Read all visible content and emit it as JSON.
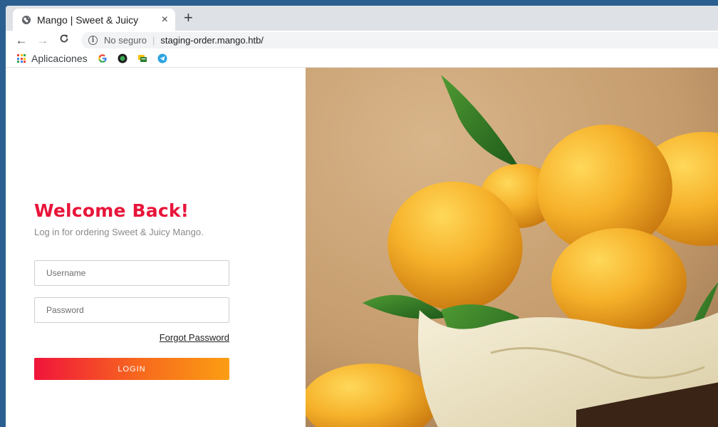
{
  "browser": {
    "tab_title": "Mango | Sweet & Juicy",
    "tab_close": "×",
    "new_tab": "+",
    "nav": {
      "back": "←",
      "forward": "→",
      "reload": "C"
    },
    "omnibox": {
      "security_label": "No seguro",
      "separator": "|",
      "url": "staging-order.mango.htb/"
    },
    "bookmarks": {
      "apps_label": "Aplicaciones"
    }
  },
  "page": {
    "heading": "Welcome Back!",
    "subtitle": "Log in for ordering Sweet & Juicy Mango.",
    "username_placeholder": "Username",
    "password_placeholder": "Password",
    "forgot_link": "Forgot Password",
    "login_button": "LOGIN"
  },
  "colors": {
    "accent": "#e8153a",
    "button_gradient": [
      "#f0143b",
      "#fb9e13"
    ]
  }
}
